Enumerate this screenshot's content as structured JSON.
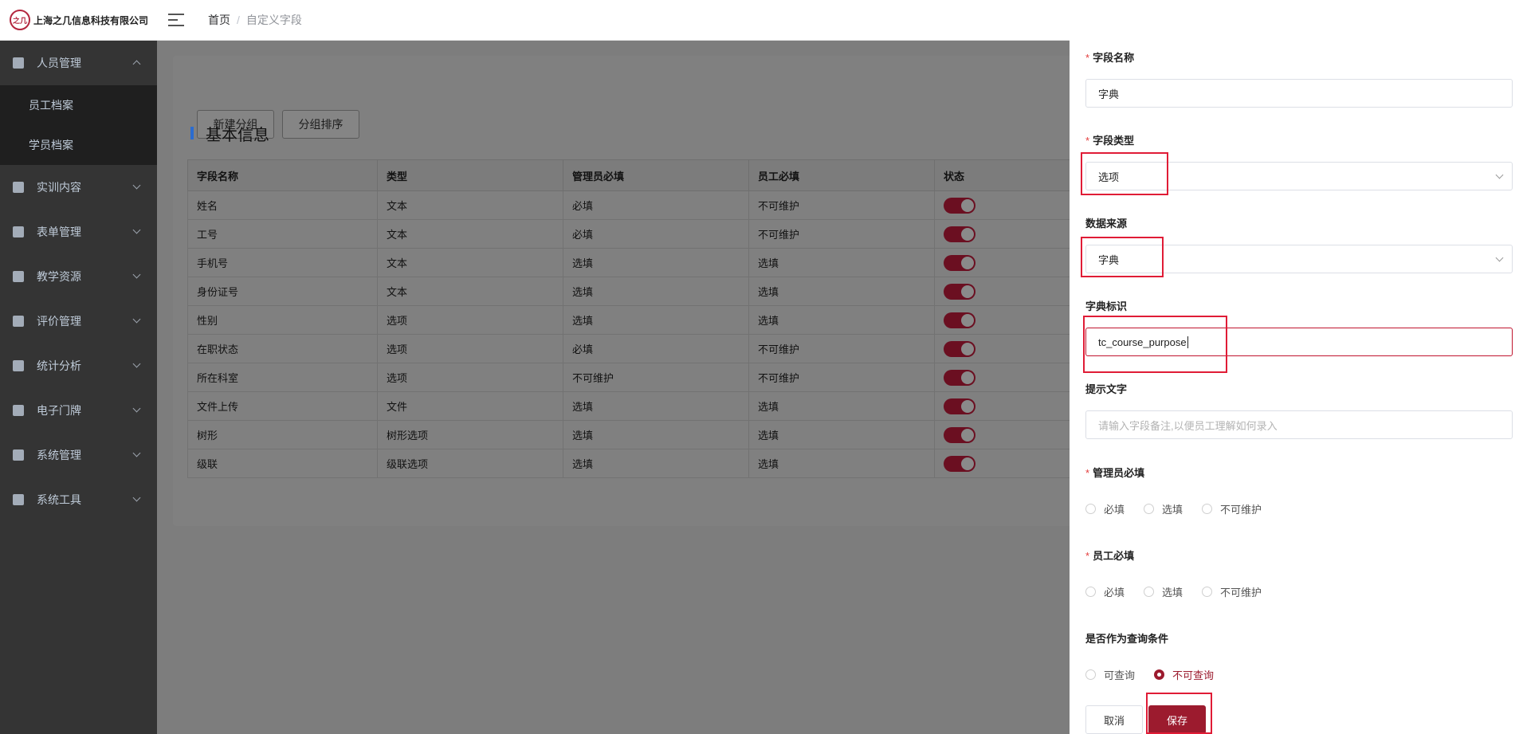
{
  "header": {
    "company": "上海之几信息科技有限公司",
    "logo_text": "之几",
    "breadcrumb": {
      "home": "首页",
      "separator": "/",
      "current": "自定义字段"
    }
  },
  "sidebar": {
    "items": [
      {
        "label": "人员管理",
        "expanded": true,
        "children": [
          "员工档案",
          "学员档案"
        ]
      },
      {
        "label": "实训内容"
      },
      {
        "label": "表单管理"
      },
      {
        "label": "教学资源"
      },
      {
        "label": "评价管理"
      },
      {
        "label": "统计分析"
      },
      {
        "label": "电子门牌"
      },
      {
        "label": "系统管理"
      },
      {
        "label": "系统工具"
      }
    ]
  },
  "main": {
    "buttons": {
      "new_group": "新建分组",
      "sort_group": "分组排序"
    },
    "section_title": "基本信息",
    "table": {
      "columns": [
        "字段名称",
        "类型",
        "管理员必填",
        "员工必填",
        "状态"
      ],
      "rows": [
        [
          "姓名",
          "文本",
          "必填",
          "不可维护"
        ],
        [
          "工号",
          "文本",
          "必填",
          "不可维护"
        ],
        [
          "手机号",
          "文本",
          "选填",
          "选填"
        ],
        [
          "身份证号",
          "文本",
          "选填",
          "选填"
        ],
        [
          "性别",
          "选项",
          "选填",
          "选填"
        ],
        [
          "在职状态",
          "选项",
          "必填",
          "不可维护"
        ],
        [
          "所在科室",
          "选项",
          "不可维护",
          "不可维护"
        ],
        [
          "文件上传",
          "文件",
          "选填",
          "选填"
        ],
        [
          "树形",
          "树形选项",
          "选填",
          "选填"
        ],
        [
          "级联",
          "级联选项",
          "选填",
          "选填"
        ]
      ]
    }
  },
  "drawer": {
    "field_name": {
      "label": "字段名称",
      "value": "字典"
    },
    "field_type": {
      "label": "字段类型",
      "value": "选项"
    },
    "data_source": {
      "label": "数据来源",
      "value": "字典"
    },
    "dict_key": {
      "label": "字典标识",
      "value": "tc_course_purpose"
    },
    "hint": {
      "label": "提示文字",
      "placeholder": "请输入字段备注,以便员工理解如何录入"
    },
    "admin_required": {
      "label": "管理员必填",
      "options": [
        "必填",
        "选填",
        "不可维护"
      ]
    },
    "staff_required": {
      "label": "员工必填",
      "options": [
        "必填",
        "选填",
        "不可维护"
      ]
    },
    "queryable": {
      "label": "是否作为查询条件",
      "options": [
        "可查询",
        "不可查询"
      ],
      "selected": "不可查询"
    },
    "cancel_label": "取消",
    "save_label": "保存"
  },
  "colors": {
    "brand": "#9c1b2e",
    "highlight": "#e01c36",
    "sidebar": "#343434"
  }
}
